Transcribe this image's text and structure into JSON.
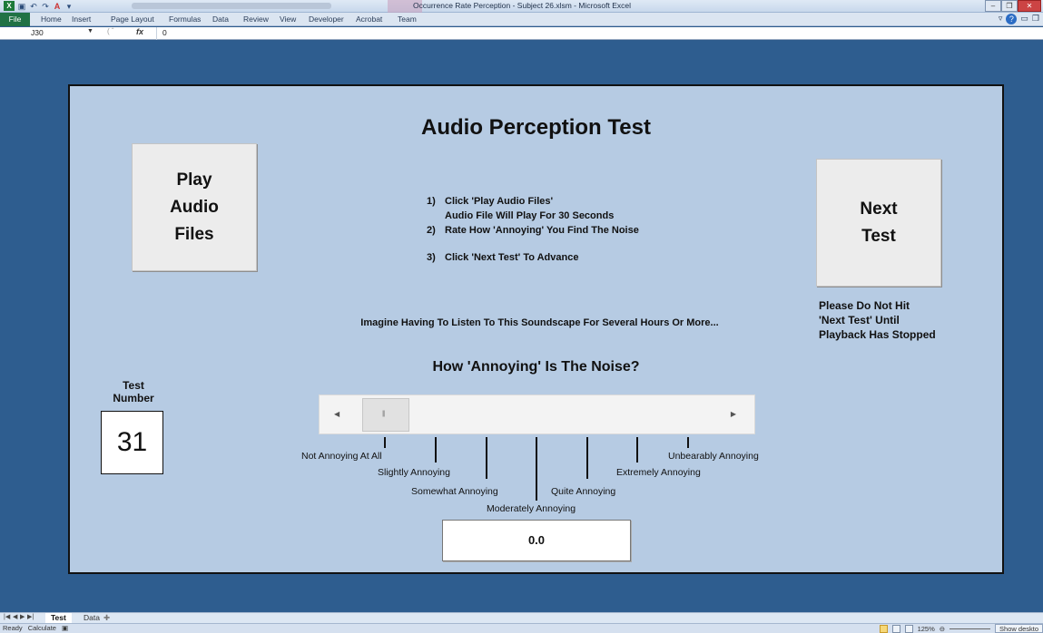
{
  "window": {
    "title": "Occurrence Rate Perception - Subject 26.xlsm - Microsoft Excel"
  },
  "ribbon": {
    "file": "File",
    "tabs": [
      "Home",
      "Insert",
      "Page Layout",
      "Formulas",
      "Data",
      "Review",
      "View",
      "Developer",
      "Acrobat",
      "Team"
    ]
  },
  "formula_bar": {
    "name_box": "J30",
    "fx": "fx",
    "value": "0"
  },
  "form": {
    "heading": "Audio Perception Test",
    "play_button": [
      "Play",
      "Audio",
      "Files"
    ],
    "next_button": [
      "Next",
      "Test"
    ],
    "instructions": {
      "step1_num": "1)",
      "step1": "Click 'Play Audio Files'",
      "step1_sub": "Audio File Will Play For 30 Seconds",
      "step2_num": "2)",
      "step2": "Rate How 'Annoying' You Find The Noise",
      "step3_num": "3)",
      "step3": "Click 'Next Test' To Advance"
    },
    "warning": [
      "Please Do Not Hit",
      "'Next Test' Until",
      "Playback Has Stopped"
    ],
    "imagine": "Imagine Having To Listen To This Soundscape For Several Hours Or More...",
    "question": "How 'Annoying' Is The Noise?",
    "test_label": [
      "Test",
      "Number"
    ],
    "test_number": "31",
    "slider_value_fraction": 0,
    "scale_labels": [
      "Not Annoying At All",
      "Slightly Annoying",
      "Somewhat Annoying",
      "Moderately Annoying",
      "Quite Annoying",
      "Extremely Annoying",
      "Unbearably Annoying"
    ],
    "output": "0.0"
  },
  "sheets": {
    "tabs": [
      "Test",
      "Data"
    ],
    "active": "Test"
  },
  "status": {
    "ready": "Ready",
    "calculate": "Calculate",
    "zoom": "125%",
    "show_desktop": "Show deskto"
  },
  "colors": {
    "panel": "#b6cbe3",
    "background": "#2e5d8f",
    "file_tab": "#207245"
  }
}
